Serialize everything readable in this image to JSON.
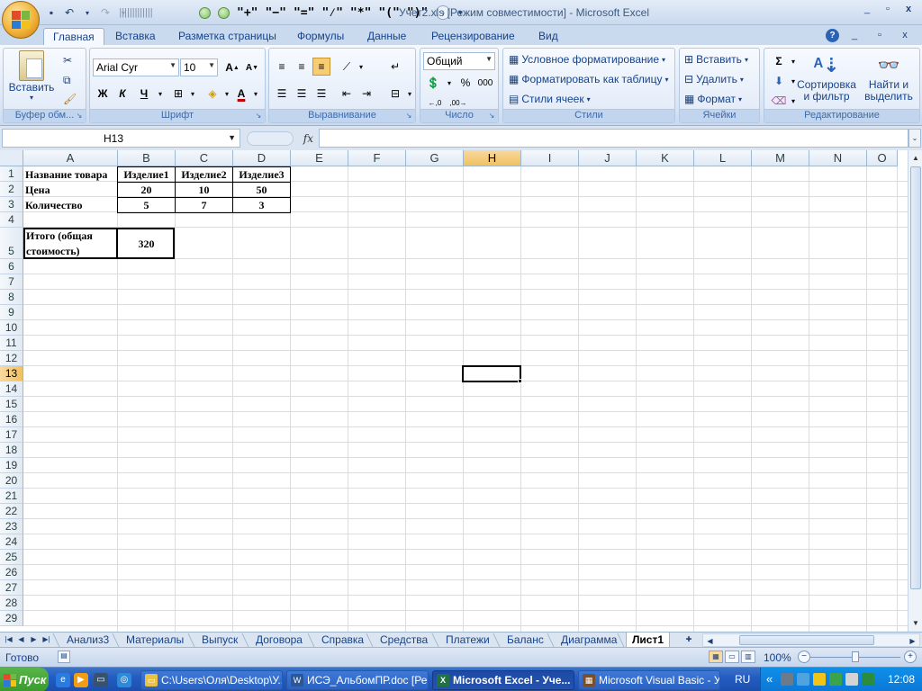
{
  "window": {
    "title": "Учет2.xls  [Режим совместимости] - Microsoft Excel",
    "controls": [
      "_",
      "▫",
      "x"
    ]
  },
  "qat": {
    "items": [
      "\"+\"",
      "\"−\"",
      "\"=\"",
      "\"⁄\"",
      "\"*\"",
      "\"(\"",
      "\")\""
    ]
  },
  "tabs": [
    "Главная",
    "Вставка",
    "Разметка страницы",
    "Формулы",
    "Данные",
    "Рецензирование",
    "Вид"
  ],
  "ribbon": {
    "clipboard": {
      "paste": "Вставить",
      "label": "Буфер обм..."
    },
    "font": {
      "name": "Arial Cyr",
      "size": "10",
      "bold": "Ж",
      "italic": "К",
      "underline": "Ч",
      "label": "Шрифт"
    },
    "alignment": {
      "label": "Выравнивание"
    },
    "number": {
      "format": "Общий",
      "percent": "%",
      "thousands": "000",
      "label": "Число"
    },
    "styles": {
      "conditional": "Условное форматирование",
      "table": "Форматировать как таблицу",
      "cell_styles": "Стили ячеек",
      "label": "Стили"
    },
    "cells": {
      "insert": "Вставить",
      "delete": "Удалить",
      "format": "Формат",
      "label": "Ячейки"
    },
    "editing": {
      "sort_line1": "Сортировка",
      "sort_line2": "и фильтр",
      "find_line1": "Найти и",
      "find_line2": "выделить",
      "label": "Редактирование"
    }
  },
  "formula_bar": {
    "name_box": "H13",
    "fx": "fx",
    "formula": ""
  },
  "columns": [
    "A",
    "B",
    "C",
    "D",
    "E",
    "F",
    "G",
    "H",
    "I",
    "J",
    "K",
    "L",
    "M",
    "N",
    "O"
  ],
  "selected_column": "H",
  "selected_row": "13",
  "rows": [
    "1",
    "2",
    "3",
    "4",
    "5",
    "6",
    "7",
    "8",
    "9",
    "10",
    "11",
    "12",
    "13",
    "14",
    "15",
    "16",
    "17",
    "18",
    "19",
    "20",
    "21",
    "22",
    "23",
    "24",
    "25",
    "26",
    "27",
    "28",
    "29"
  ],
  "cells": {
    "A1": "Название товара",
    "B1": "Изделие1",
    "C1": "Изделие2",
    "D1": "Изделие3",
    "A2": "Цена",
    "B2": "20",
    "C2": "10",
    "D2": "50",
    "A3": "Количество",
    "B3": "5",
    "C3": "7",
    "D3": "3",
    "A5_line1": "Итого (общая",
    "A5_line2": "стоимость)",
    "B5": "320"
  },
  "sheet_tabs": [
    "Анализ3",
    "Материалы",
    "Выпуск",
    "Договора",
    "Справка",
    "Средства",
    "Платежи",
    "Баланс",
    "Диаграмма",
    "Лист1"
  ],
  "active_sheet": "Лист1",
  "status": {
    "ready": "Готово",
    "zoom": "100%"
  },
  "taskbar": {
    "start": "Пуск",
    "items": [
      "C:\\Users\\Оля\\Desktop\\У...",
      "ИСЭ_АльбомПР.doc [Ре...",
      "Microsoft Excel - Уче...",
      "Microsoft Visual Basic - У..."
    ],
    "lang": "RU",
    "time": "12:08",
    "tray_chevron": "«"
  }
}
